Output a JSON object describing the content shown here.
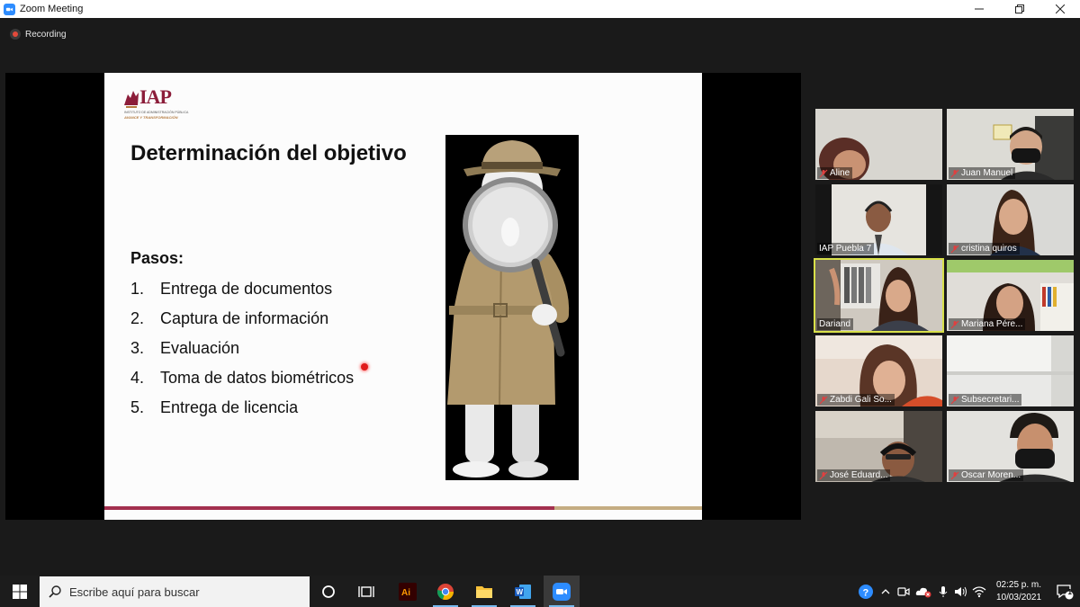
{
  "window": {
    "title": "Zoom Meeting",
    "controls": [
      "minimize",
      "restore",
      "close"
    ]
  },
  "recording": {
    "label": "Recording"
  },
  "slide": {
    "logo": {
      "text": "IAP",
      "subtitle": "INSTITUTO DE ADMINISTRACIÓN PÚBLICA",
      "tagline": "AVANCE Y TRANSFORMACIÓN"
    },
    "title": "Determinación del objetivo",
    "steps_heading": "Pasos:",
    "steps": [
      {
        "num": "1.",
        "text": "Entrega de documentos"
      },
      {
        "num": "2.",
        "text": "Captura de información"
      },
      {
        "num": "3.",
        "text": "Evaluación"
      },
      {
        "num": "4.",
        "text": "Toma de datos biométricos"
      },
      {
        "num": "5.",
        "text": "Entrega de licencia"
      }
    ],
    "image": "detective-with-magnifying-glass"
  },
  "participants": [
    {
      "name": "Aline",
      "muted": true,
      "active": false
    },
    {
      "name": "Juan Manuel",
      "muted": true,
      "active": false
    },
    {
      "name": "IAP Puebla 7",
      "muted": false,
      "active": false
    },
    {
      "name": "cristina quiros",
      "muted": true,
      "active": false
    },
    {
      "name": "Dariand",
      "muted": false,
      "active": true
    },
    {
      "name": "Mariana Pére...",
      "muted": true,
      "active": false
    },
    {
      "name": "Zabdi Gali So...",
      "muted": true,
      "active": false
    },
    {
      "name": "Subsecretari...",
      "muted": true,
      "active": false
    },
    {
      "name": "José Eduard...",
      "muted": true,
      "active": false
    },
    {
      "name": "Oscar Moren...",
      "muted": true,
      "active": false
    }
  ],
  "taskbar": {
    "search_placeholder": "Escribe aquí para buscar",
    "apps": [
      "cortana",
      "task-view",
      "adobe-illustrator",
      "chrome",
      "file-explorer",
      "word",
      "zoom"
    ],
    "clock": {
      "time": "02:25 p. m.",
      "date": "10/03/2021"
    },
    "notification_count": "1"
  },
  "colors": {
    "accent_maroon": "#a3304f",
    "accent_gold": "#c5ad82",
    "active_speaker": "#d8e04a",
    "zoom_blue": "#2d8cff"
  }
}
